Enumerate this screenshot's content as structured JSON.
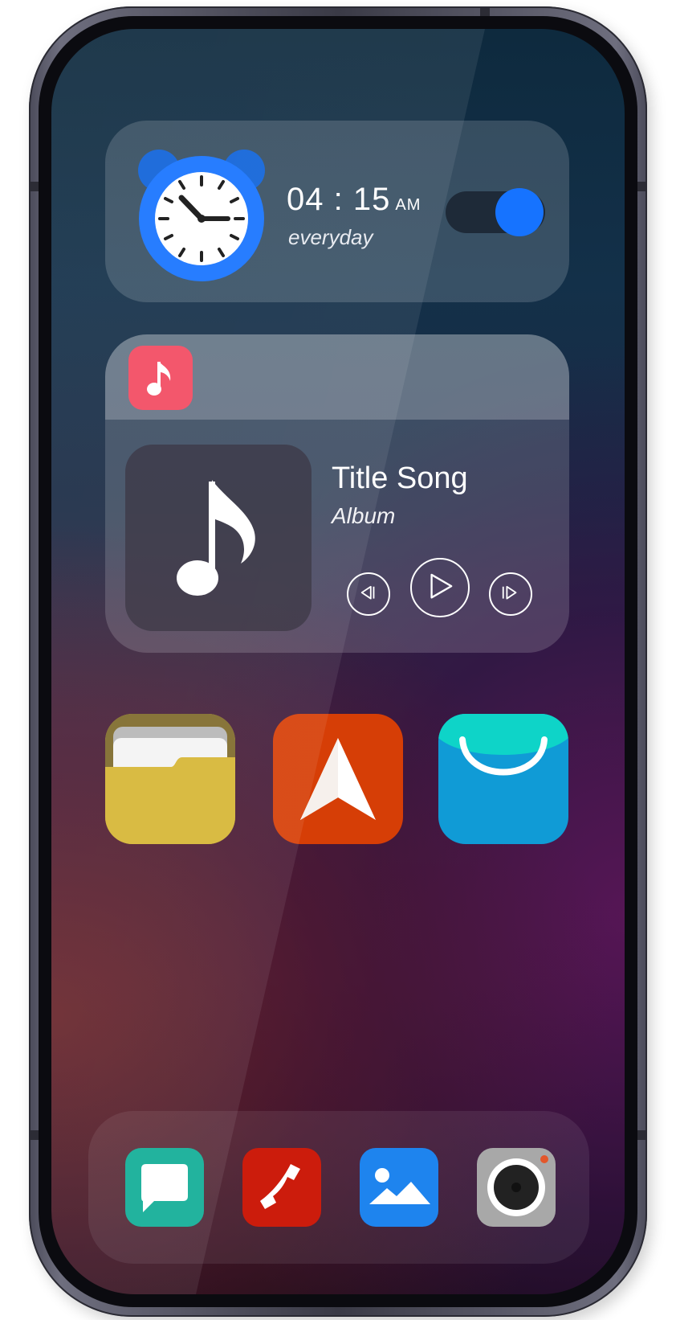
{
  "alarm": {
    "hour": "04",
    "separator": ":",
    "minute": "15",
    "ampm": "AM",
    "repeat": "everyday",
    "enabled": true,
    "accent_color": "#1673ff"
  },
  "music": {
    "title": "Title Song",
    "album": "Album",
    "app_color": "#f24a60"
  },
  "apps": [
    {
      "name": "files",
      "icon": "folder-icon",
      "color": "#d6b634"
    },
    {
      "name": "navigation",
      "icon": "arrow-up-icon",
      "color": "#d63e06"
    },
    {
      "name": "store",
      "icon": "shopping-bag-icon",
      "color": "#109bd6"
    }
  ],
  "dock": [
    {
      "name": "messages",
      "icon": "message-icon",
      "color": "#10ad96"
    },
    {
      "name": "phone",
      "icon": "phone-icon",
      "color": "#cc1c0c"
    },
    {
      "name": "gallery",
      "icon": "image-icon",
      "color": "#1e84ee"
    },
    {
      "name": "camera",
      "icon": "camera-icon",
      "color": "#a8a8a8"
    }
  ]
}
